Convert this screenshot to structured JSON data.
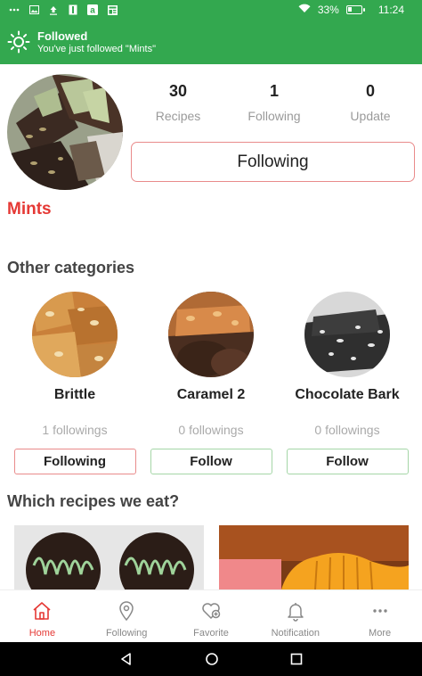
{
  "status_bar": {
    "icons": [
      "more-icon",
      "image-icon",
      "upload-icon",
      "book-icon",
      "amazon-icon",
      "news-icon"
    ],
    "battery": "33%",
    "battery_level": 0.33,
    "time": "11:24"
  },
  "notification": {
    "icon": "sun-icon",
    "title": "Followed",
    "message": "You've just followed \"Mints\""
  },
  "profile": {
    "name": "Mints",
    "stats": [
      {
        "value": "30",
        "label": "Recipes"
      },
      {
        "value": "1",
        "label": "Following"
      },
      {
        "value": "0",
        "label": "Update"
      }
    ],
    "follow_button": "Following"
  },
  "other_categories": {
    "title": "Other categories",
    "items": [
      {
        "name": "Brittle",
        "count": "1 followings",
        "button": "Following"
      },
      {
        "name": "Caramel 2",
        "count": "0 followings",
        "button": "Follow"
      },
      {
        "name": "Chocolate Bark",
        "count": "0 followings",
        "button": "Follow"
      }
    ]
  },
  "recipes_section": {
    "title": "Which recipes we eat?"
  },
  "bottom_nav": {
    "items": [
      {
        "label": "Home",
        "icon": "home-icon",
        "active": true
      },
      {
        "label": "Following",
        "icon": "location-pin-icon",
        "active": false
      },
      {
        "label": "Favorite",
        "icon": "heart-plus-icon",
        "active": false
      },
      {
        "label": "Notification",
        "icon": "bell-icon",
        "active": false
      },
      {
        "label": "More",
        "icon": "more-icon",
        "active": false
      }
    ]
  },
  "colors": {
    "brand_green": "#33a84f",
    "accent_red": "#e53935",
    "following_border": "#e98b8b",
    "follow_border": "#a5d6a7"
  }
}
